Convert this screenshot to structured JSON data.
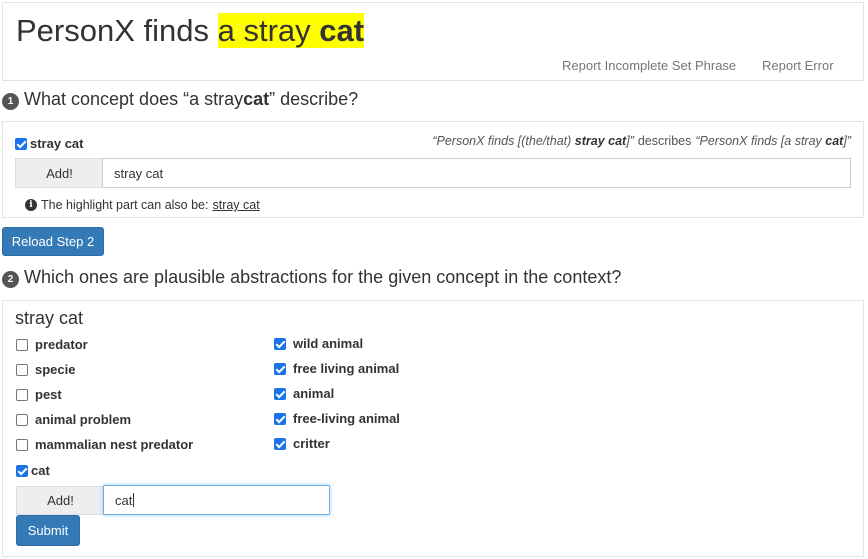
{
  "header": {
    "title_prefix": "PersonX finds ",
    "title_hl_plain": "a stray ",
    "title_hl_bold": "cat",
    "link_incomplete": "Report Incomplete Set Phrase",
    "link_error": "Report Error"
  },
  "step1": {
    "number": "1",
    "question_prefix": "What concept does “a stray ",
    "question_bold": "cat",
    "question_suffix": "” describe?",
    "checkbox_label": "stray cat",
    "checkbox_checked": true,
    "desc_part1": "“PersonX finds [(the/that) ",
    "desc_bold1": "stray cat",
    "desc_part2": "]”",
    "desc_describes": "describes",
    "desc_part3": "“PersonX finds [a stray ",
    "desc_bold2": "cat",
    "desc_part4": "]”",
    "add_label": "Add!",
    "input_value": "stray cat",
    "hint_text": "The highlight part can also be:",
    "hint_link": "stray cat"
  },
  "reload_label": "Reload Step 2",
  "step2": {
    "number": "2",
    "question": "Which ones are plausible abstractions for the given concept in the context?",
    "concept": "stray cat",
    "options_left": [
      {
        "label": "predator",
        "checked": false
      },
      {
        "label": "specie",
        "checked": false
      },
      {
        "label": "pest",
        "checked": false
      },
      {
        "label": "animal problem",
        "checked": false
      },
      {
        "label": "mammalian nest predator",
        "checked": false
      },
      {
        "label": "cat",
        "checked": true
      }
    ],
    "options_right": [
      {
        "label": "wild animal",
        "checked": true
      },
      {
        "label": "free living animal",
        "checked": true
      },
      {
        "label": "animal",
        "checked": true
      },
      {
        "label": "free-living animal",
        "checked": true
      },
      {
        "label": "critter",
        "checked": true
      }
    ],
    "add_label": "Add!",
    "input_value": "cat",
    "submit_label": "Submit"
  },
  "colors": {
    "highlight": "#ffff00",
    "primary_button": "#337ab7",
    "checkbox_checked": "#1a73e8"
  }
}
